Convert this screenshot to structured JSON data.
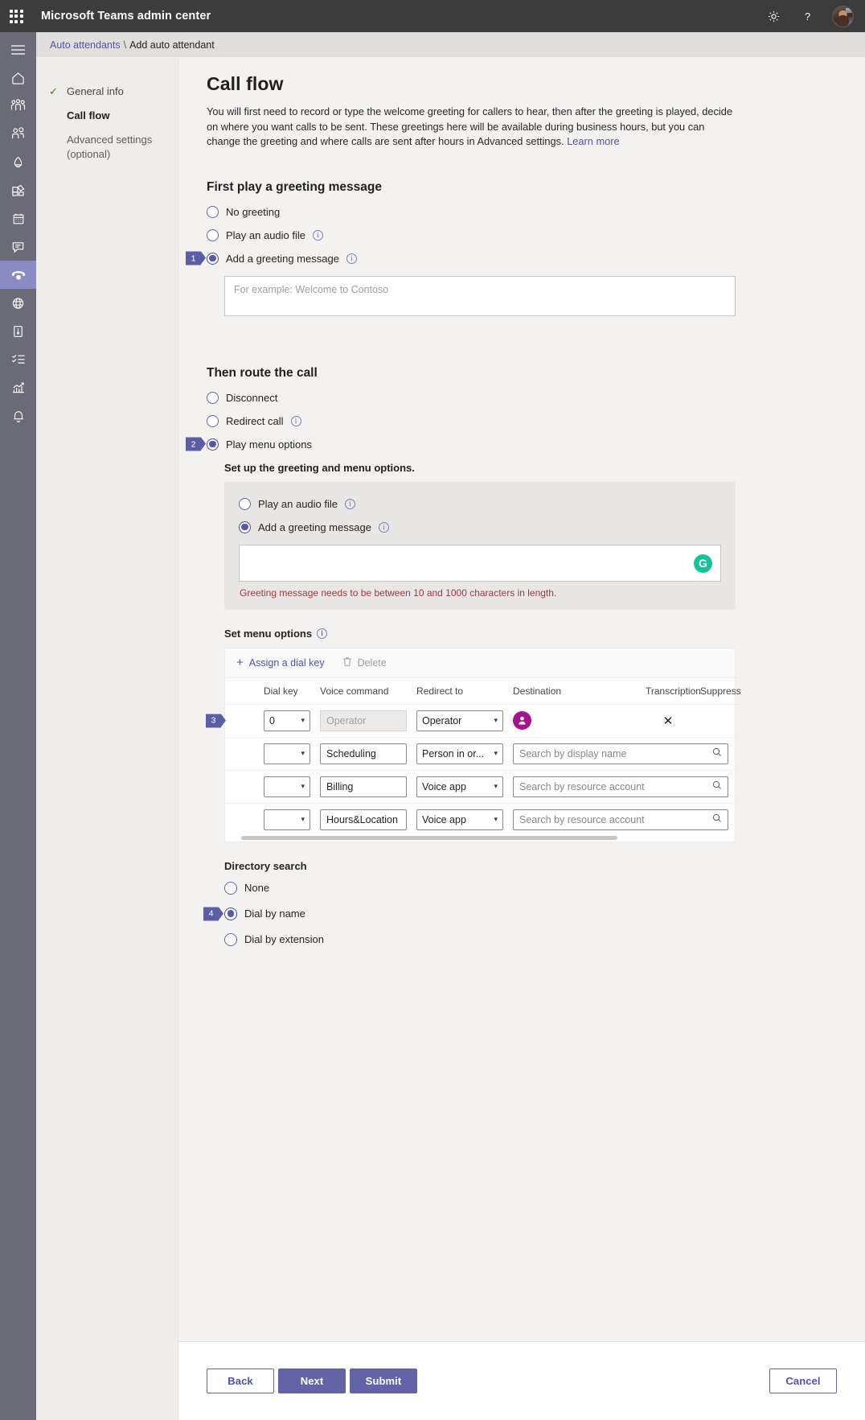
{
  "suite": {
    "title": "Microsoft Teams admin center",
    "waffle_icon": "app-launcher-icon",
    "settings_icon": "gear-icon",
    "help_icon": "help-question-icon",
    "avatar_icon": "user-avatar"
  },
  "rail": {
    "items": [
      {
        "name": "hamburger-menu-icon",
        "label": "Menu"
      },
      {
        "name": "home-icon",
        "label": "Home"
      },
      {
        "name": "teams-icon",
        "label": "Teams"
      },
      {
        "name": "users-icon",
        "label": "Users"
      },
      {
        "name": "meetings-icon",
        "label": "Meetings"
      },
      {
        "name": "apps-icon",
        "label": "Teams apps"
      },
      {
        "name": "calendar-icon",
        "label": "Meetings"
      },
      {
        "name": "messaging-icon",
        "label": "Messaging policies"
      },
      {
        "name": "voice-phone-icon",
        "label": "Voice"
      },
      {
        "name": "globe-icon",
        "label": "Locations"
      },
      {
        "name": "devices-icon",
        "label": "Devices"
      },
      {
        "name": "policy-checklist-icon",
        "label": "Policy packages"
      },
      {
        "name": "analytics-icon",
        "label": "Analytics & reports"
      },
      {
        "name": "notifications-bell-icon",
        "label": "Notifications & alerts"
      }
    ]
  },
  "breadcrumb": {
    "parent": "Auto attendants",
    "separator": "\\",
    "current": "Add auto attendant"
  },
  "steps": [
    {
      "label": "General info",
      "state": "complete",
      "check": "✓"
    },
    {
      "label": "Call flow",
      "state": "current",
      "check": ""
    },
    {
      "label": "Advanced settings (optional)",
      "state": "muted",
      "check": ""
    }
  ],
  "page": {
    "title": "Call flow",
    "description": "You will first need to record or type the welcome greeting for callers to hear, then after the greeting is played, decide on where you want calls to be sent. These greetings here will be available during business hours, but you can change the greeting and where calls are sent after hours in Advanced settings.",
    "learn_more": "Learn more"
  },
  "greeting_section": {
    "title": "First play a greeting message",
    "options": [
      {
        "label": "No greeting",
        "checked": false,
        "info": false
      },
      {
        "label": "Play an audio file",
        "checked": false,
        "info": true
      },
      {
        "label": "Add a greeting message",
        "checked": true,
        "info": true,
        "callout": "1"
      }
    ],
    "textarea_placeholder": "For example: Welcome to Contoso",
    "textarea_value": ""
  },
  "route_section": {
    "title": "Then route the call",
    "options": [
      {
        "label": "Disconnect",
        "checked": false,
        "info": false
      },
      {
        "label": "Redirect call",
        "checked": false,
        "info": true
      },
      {
        "label": "Play menu options",
        "checked": true,
        "info": false,
        "callout": "2"
      }
    ],
    "subpanel_heading": "Set up the greeting and menu options.",
    "menu_greeting_options": [
      {
        "label": "Play an audio file",
        "checked": false,
        "info": true
      },
      {
        "label": "Add a greeting message",
        "checked": true,
        "info": true
      }
    ],
    "menu_textarea_value": "",
    "grammarly_icon": "grammarly-icon",
    "grammarly_glyph": "G",
    "error": "Greeting message needs to be between 10 and 1000 characters in length."
  },
  "menu_options": {
    "title": "Set menu options",
    "toolbar": {
      "assign_label": "Assign a dial key",
      "assign_icon": "plus-icon",
      "delete_label": "Delete",
      "delete_icon": "trash-icon",
      "delete_disabled": true
    },
    "columns": [
      "Dial key",
      "Voice command",
      "Redirect to",
      "Destination",
      "Transcription",
      "Suppress"
    ],
    "rows": [
      {
        "callout": "3",
        "dial_key": "0",
        "voice_command": "Operator",
        "voice_readonly": true,
        "redirect_to": "Operator",
        "destination_type": "persona",
        "destination_value": "",
        "destination_placeholder": "",
        "remove_icon": "close-x-icon"
      },
      {
        "callout": "",
        "dial_key": "",
        "voice_command": "Scheduling",
        "voice_readonly": false,
        "redirect_to": "Person in or...",
        "destination_type": "search",
        "destination_value": "",
        "destination_placeholder": "Search by display name",
        "search_icon": "magnifier-icon"
      },
      {
        "callout": "",
        "dial_key": "",
        "voice_command": "Billing",
        "voice_readonly": false,
        "redirect_to": "Voice app",
        "destination_type": "search",
        "destination_value": "",
        "destination_placeholder": "Search by resource account",
        "search_icon": "magnifier-icon"
      },
      {
        "callout": "",
        "dial_key": "",
        "voice_command": "Hours&Location",
        "voice_readonly": false,
        "redirect_to": "Voice app",
        "destination_type": "search",
        "destination_value": "",
        "destination_placeholder": "Search by resource account",
        "search_icon": "magnifier-icon"
      }
    ]
  },
  "directory_search": {
    "title": "Directory search",
    "options": [
      {
        "label": "None",
        "checked": false
      },
      {
        "label": "Dial by name",
        "checked": true,
        "callout": "4"
      },
      {
        "label": "Dial by extension",
        "checked": false
      }
    ]
  },
  "footer": {
    "back": "Back",
    "next": "Next",
    "submit": "Submit",
    "cancel": "Cancel"
  },
  "colors": {
    "accent": "#6264a7",
    "callout": "#5b5ea6",
    "error": "#a4373a",
    "persona": "#a4138a",
    "grammarly": "#15c39a",
    "check": "#498205"
  }
}
